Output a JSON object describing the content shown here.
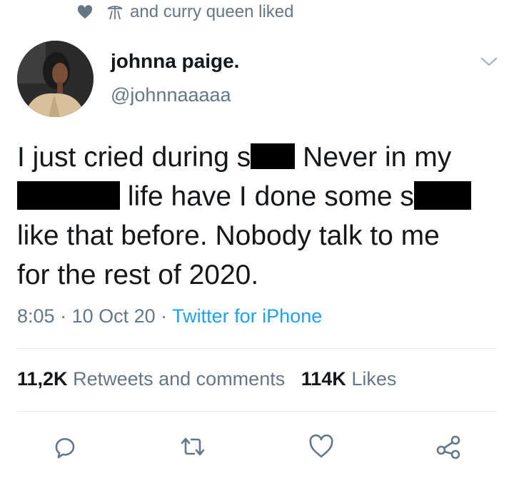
{
  "social_context": {
    "liked_text": "and curry queen liked",
    "heart_icon": "heart-filled-icon",
    "bot_icon": "bot-icon"
  },
  "author": {
    "display_name": "johnna paige.",
    "handle": "@johnnaaaaa",
    "more_icon": "chevron-down-icon"
  },
  "tweet": {
    "line1_a": "I just cried during s",
    "line1_b": " Never in my",
    "line2": " life have I done some s",
    "line3": "like that before. Nobody talk to me",
    "line4": "for the rest of 2020."
  },
  "meta": {
    "time": "8:05",
    "separator": " · ",
    "date": "10 Oct 20",
    "source": "Twitter for iPhone"
  },
  "stats": {
    "retweets_count": "11,2K",
    "retweets_label": "Retweets and comments",
    "likes_count": "114K",
    "likes_label": "Likes"
  },
  "actions": [
    "reply-icon",
    "retweet-icon",
    "like-icon",
    "share-icon"
  ],
  "colors": {
    "text": "#14171a",
    "secondary": "#657786",
    "link": "#1da1f2",
    "divider": "#e1e8ed"
  }
}
